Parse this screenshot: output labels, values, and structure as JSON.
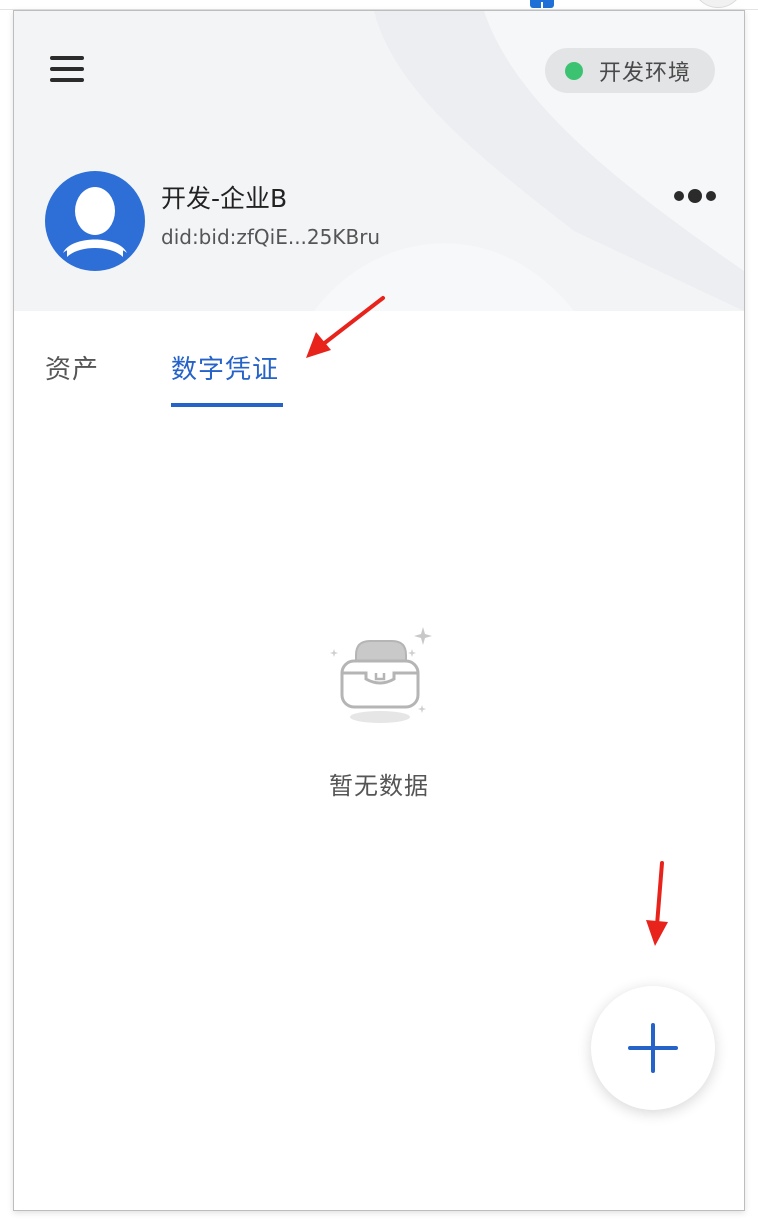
{
  "header": {
    "menu_icon": "hamburger-menu-icon",
    "environment": {
      "label": "开发环境",
      "status_color": "#3cc371"
    },
    "account": {
      "name": "开发-企业B",
      "did": "did:bid:zfQiE...25KBru",
      "avatar_icon": "user-avatar-icon",
      "avatar_color": "#2d6fd6"
    },
    "more_icon": "more-dots-icon"
  },
  "tabs": [
    {
      "label": "资产",
      "active": false
    },
    {
      "label": "数字凭证",
      "active": true
    }
  ],
  "empty_state": {
    "text": "暂无数据",
    "icon": "empty-box-icon"
  },
  "fab": {
    "icon": "plus-icon"
  },
  "colors": {
    "accent": "#2563c9",
    "annotation": "#e8231b"
  }
}
